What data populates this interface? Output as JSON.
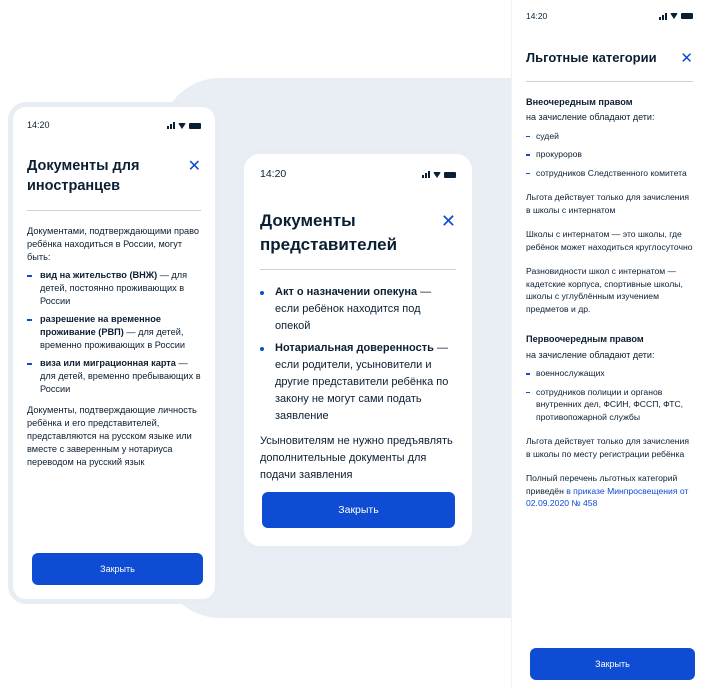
{
  "status": {
    "time": "14:20"
  },
  "foreigners": {
    "title": "Документы для иностранцев",
    "intro": "Документами, подтверждающими право ребёнка находиться в России, могут быть:",
    "items": [
      {
        "bold": "вид на жительство (ВНЖ)",
        "rest": " — для детей, постоянно проживающих в России"
      },
      {
        "bold": "разрешение на временное проживание (РВП)",
        "rest": " — для детей, временно проживающих в России"
      },
      {
        "bold": "виза или миграционная карта",
        "rest": " — для детей, временно пребывающих в России"
      }
    ],
    "outro": "Документы, подтверждающие личность ребёнка и его представителей, представляются на русском языке или вместе с заверенным у нотариуса переводом на русский язык",
    "button": "Закрыть"
  },
  "representatives": {
    "title": "Документы представителей",
    "items": [
      {
        "bold": "Акт о назначении опекуна",
        "rest": " — если ребёнок находится под опекой"
      },
      {
        "bold": "Нотариальная доверенность",
        "rest": " — если родители, усыновители и другие представители ребёнка по закону не могут сами подать заявление"
      }
    ],
    "outro": "Усыновителям не нужно предъявлять дополнительные документы для подачи заявления",
    "button": "Закрыть"
  },
  "privileged": {
    "title": "Льготные категории",
    "section1": {
      "title": "Внеочередным правом",
      "subtitle": "на зачисление обладают дети:",
      "items": [
        "судей",
        "прокуроров",
        "сотрудников Следственного комитета"
      ]
    },
    "p1": "Льгота действует только для зачисления в школы с интернатом",
    "p2": "Школы с интернатом — это школы, где ребёнок может находиться круглосуточно",
    "p3": "Разновидности школ с интернатом — кадетские корпуса, спортивные школы, школы с углублённым изучением предметов и др.",
    "section2": {
      "title": "Первоочередным правом",
      "subtitle": "на зачисление обладают дети:",
      "items": [
        "военнослужащих",
        "сотрудников полиции и органов внутренних дел, ФСИН, ФССП, ФТС, противопожарной службы"
      ]
    },
    "p4": "Льгота действует только для зачисления в школы по месту регистрации ребёнка",
    "p5_text": "Полный перечень льготных категорий приведён ",
    "p5_link": "в приказе Минпросвещения от 02.09.2020 № 458",
    "button": "Закрыть"
  },
  "colors": {
    "accent": "#0d4cd3",
    "text": "#0b1f33",
    "frame": "#e8edf3"
  },
  "icons": {
    "close": "close-icon",
    "signal": "signal-icon",
    "wifi": "wifi-icon",
    "battery": "battery-icon"
  }
}
